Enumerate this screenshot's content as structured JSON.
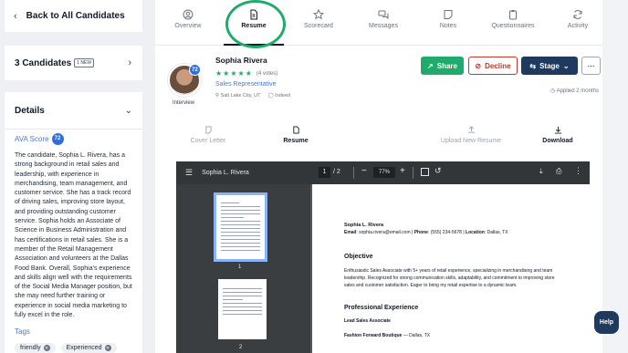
{
  "sidebar": {
    "back_label": "Back to All Candidates",
    "candidates_label": "3 Candidates",
    "candidates_badge": "1 NEW",
    "details_label": "Details",
    "ava_label": "AVA Score",
    "ava_score": "72",
    "summary": "The candidate, Sophia L. Rivera, has a strong background in retail sales and leadership, with experience in merchandising, team management, and customer service. She has a track record of driving sales, improving store layout, and providing outstanding customer service. Sophia holds an Associate of Science in Business Administration and has certifications in retail sales. She is a member of the Retail Management Association and volunteers at the Dallas Food Bank. Overall, Sophia's experience and skills align well with the requirements of the Social Media Manager position, but she may need further training or experience in social media marketing to fully excel in the role.",
    "tags_label": "Tags",
    "tags": [
      "friendly",
      "Experienced"
    ]
  },
  "tabs": [
    {
      "label": "Overview",
      "icon": "user-circle-icon"
    },
    {
      "label": "Resume",
      "icon": "document-icon"
    },
    {
      "label": "Scorecard",
      "icon": "star-icon"
    },
    {
      "label": "Messages",
      "icon": "chat-icon"
    },
    {
      "label": "Notes",
      "icon": "note-icon"
    },
    {
      "label": "Questionnaires",
      "icon": "clipboard-icon"
    },
    {
      "label": "Activity",
      "icon": "refresh-icon"
    }
  ],
  "profile": {
    "name": "Sophia Rivera",
    "score": "72",
    "stage_tag": "Interview",
    "votes": "(4 votes)",
    "rating": 5,
    "role": "Sales Representative",
    "location": "Salt Lake City, UT",
    "source": "Indeed",
    "applied": "Applied 2 months"
  },
  "actions": {
    "share": "Share",
    "decline": "Decline",
    "stage": "Stage",
    "more": "⋯"
  },
  "doc_tabs": {
    "cover_letter": "Cover Letter",
    "resume": "Resume",
    "upload": "Upload New Resume",
    "download": "Download"
  },
  "pdf": {
    "title": "Sophia L. Rivera",
    "page_current": "1",
    "page_total": "/ 2",
    "zoom": "77%",
    "thumb1_num": "1",
    "thumb2_num": "2",
    "doc": {
      "name": "Sophia L. Rivera",
      "contact_email_label": "Email",
      "contact_email": "sophia.rivera@email.com",
      "contact_phone_label": "Phone",
      "contact_phone": "(555) 234-5678",
      "contact_location_label": "Location",
      "contact_location": "Dallas, TX",
      "objective_heading": "Objective",
      "objective_text": "Enthusiastic Sales Associate with 5+ years of retail experience, specializing in merchandising and team leadership. Recognized for strong communication skills, adaptability, and commitment to improving store sales and customer satisfaction. Eager to bring my retail expertise to a dynamic team.",
      "experience_heading": "Professional Experience",
      "job_title": "Lead Sales Associate",
      "company": "Fashion Forward Boutique",
      "company_location": "— Dallas, TX"
    }
  },
  "help_label": "Help",
  "colors": {
    "accent_green": "#1fab6c",
    "decline_red": "#c0392b",
    "stage_navy": "#1e3a5f",
    "score_blue": "#2f6fdc"
  }
}
